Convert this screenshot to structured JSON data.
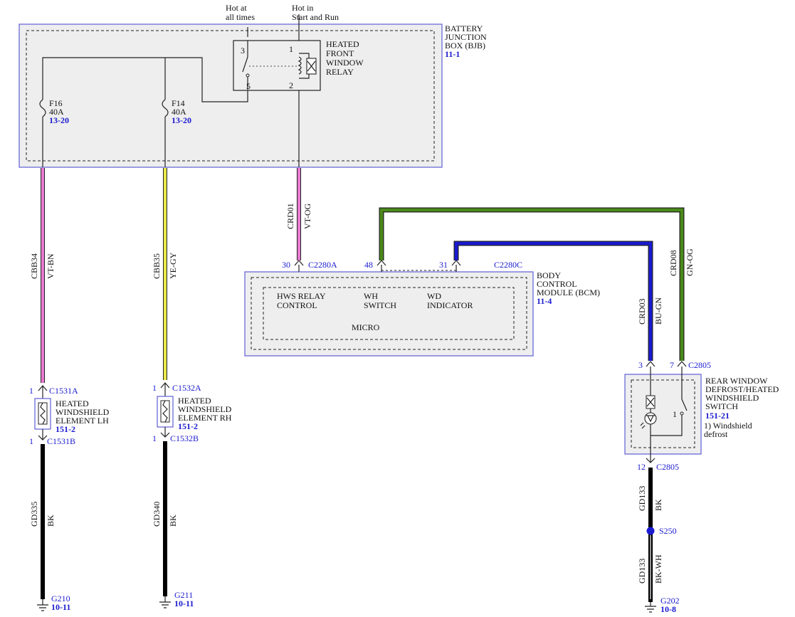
{
  "supply": {
    "hot_at_all_times": [
      "Hot at",
      "all times"
    ],
    "hot_in_start_run": [
      "Hot in",
      "Start and Run"
    ]
  },
  "bjb": {
    "name": [
      "BATTERY",
      "JUNCTION",
      "BOX (BJB)"
    ],
    "ref": "11-1",
    "fuse_f16": {
      "name": "F16",
      "rating": "40A",
      "ref": "13-20"
    },
    "fuse_f14": {
      "name": "F14",
      "rating": "40A",
      "ref": "13-20"
    },
    "relay": {
      "name": [
        "HEATED",
        "FRONT",
        "WINDOW",
        "RELAY"
      ],
      "pin_3": "3",
      "pin_5": "5",
      "pin_1": "1",
      "pin_2": "2"
    }
  },
  "wires": {
    "cbb34": {
      "circuit": "CBB34",
      "color": "VT-BN",
      "hex": "#e87ad0"
    },
    "cbb35": {
      "circuit": "CBB35",
      "color": "YE-GY",
      "hex": "#e8e84a"
    },
    "crd01": {
      "circuit": "CRD01",
      "color": "VT-OG",
      "hex": "#e87ad0"
    },
    "crd08": {
      "circuit": "CRD08",
      "color": "GN-OG",
      "hex": "#4a8a1a"
    },
    "crd03": {
      "circuit": "CRD03",
      "color": "BU-GN",
      "hex": "#1a1ad0"
    },
    "gd335": {
      "circuit": "GD335",
      "color": "BK",
      "hex": "#000000"
    },
    "gd340": {
      "circuit": "GD340",
      "color": "BK",
      "hex": "#000000"
    },
    "gd133_upper": {
      "circuit": "GD133",
      "color": "BK",
      "hex": "#000000"
    },
    "gd133_lower": {
      "circuit": "GD133",
      "color": "BK-WH",
      "hex": "#000000"
    }
  },
  "bcm": {
    "name": [
      "BODY",
      "CONTROL",
      "MODULE (BCM)"
    ],
    "ref": "11-4",
    "connector_a": {
      "pin": "30",
      "name": "C2280A"
    },
    "pin_48": "48",
    "pin_31": "31",
    "connector_c": "C2280C",
    "hws_label": [
      "HWS RELAY",
      "CONTROL"
    ],
    "wh_label": [
      "WH",
      "SWITCH"
    ],
    "wd_label": [
      "WD",
      "INDICATOR"
    ],
    "micro": "MICRO"
  },
  "lh_element": {
    "top": {
      "pin": "1",
      "name": "C1531A"
    },
    "bottom": {
      "pin": "1",
      "name": "C1531B"
    },
    "name": [
      "HEATED",
      "WINDSHIELD",
      "ELEMENT LH"
    ],
    "ref": "151-2"
  },
  "rh_element": {
    "top": {
      "pin": "1",
      "name": "C1532A"
    },
    "bottom": {
      "pin": "1",
      "name": "C1532B"
    },
    "name": [
      "HEATED",
      "WINDSHIELD",
      "ELEMENT RH"
    ],
    "ref": "151-2"
  },
  "rear_switch": {
    "pin_3": "3",
    "pin_7": "7",
    "connector": "C2805",
    "name": [
      "REAR WINDOW",
      "DEFROST/HEATED",
      "WINDSHIELD",
      "SWITCH"
    ],
    "ref": "151-21",
    "note": [
      "1) Windshield",
      "defrost"
    ],
    "contact": "1",
    "bottom": {
      "pin": "12",
      "name": "C2805"
    }
  },
  "splice": {
    "name": "S250"
  },
  "grounds": {
    "g210": {
      "name": "G210",
      "ref": "10-11"
    },
    "g211": {
      "name": "G211",
      "ref": "10-11"
    },
    "g202": {
      "name": "G202",
      "ref": "10-8"
    }
  }
}
